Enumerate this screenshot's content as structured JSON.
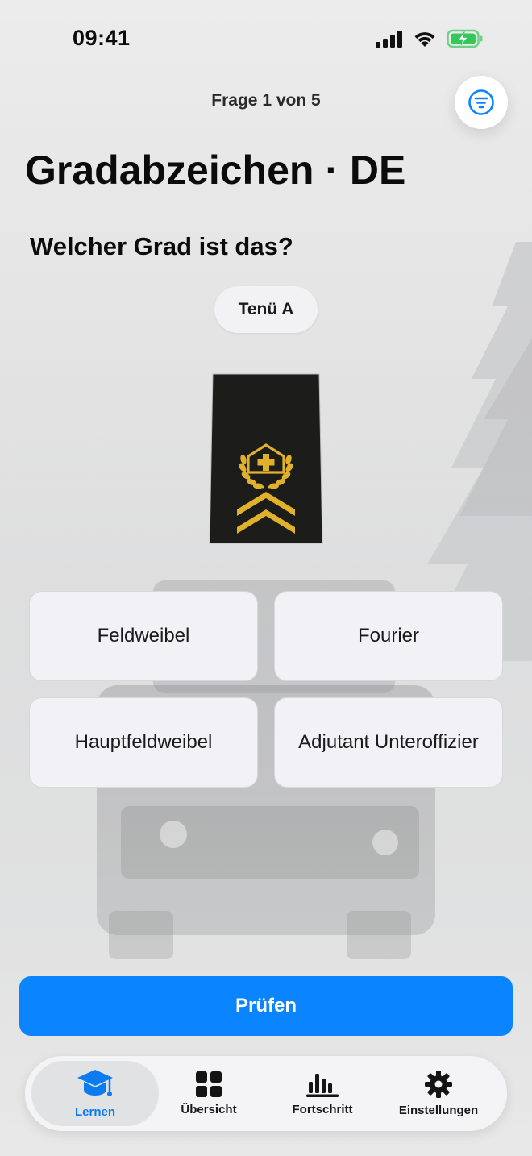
{
  "status_bar": {
    "time": "09:41"
  },
  "header": {
    "counter": "Frage 1 von 5"
  },
  "title": "Gradabzeichen · DE",
  "question": "Welcher Grad ist das?",
  "uniform_chip": "Tenü A",
  "answers": [
    "Feldweibel",
    "Fourier",
    "Hauptfeldweibel",
    "Adjutant Unteroffizier"
  ],
  "check_button": "Prüfen",
  "tab_bar": {
    "items": [
      {
        "label": "Lernen",
        "icon": "graduation-cap-icon",
        "active": true
      },
      {
        "label": "Übersicht",
        "icon": "grid-icon",
        "active": false
      },
      {
        "label": "Fortschritt",
        "icon": "bar-chart-icon",
        "active": false
      },
      {
        "label": "Einstellungen",
        "icon": "gear-icon",
        "active": false
      }
    ]
  },
  "colors": {
    "accent": "#0a84ff",
    "battery": "#34c759",
    "insignia_bg": "#1c1c1a",
    "insignia_gold": "#e1b12c"
  }
}
